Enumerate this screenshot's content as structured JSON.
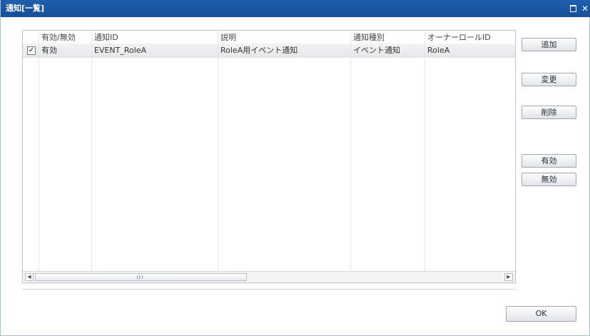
{
  "window": {
    "title": "通知[一覧]",
    "close_glyph": "✕"
  },
  "grid": {
    "columns": [
      "有効/無効",
      "通知ID",
      "説明",
      "通知種別",
      "オーナーロールID"
    ],
    "rows": [
      {
        "checked": true,
        "check_glyph": "✓",
        "status": "有効",
        "notification_id": "EVENT_RoleA",
        "description": "RoleA用イベント通知",
        "type": "イベント通知",
        "owner_role_id": "RoleA"
      }
    ],
    "scroll_left_glyph": "◀",
    "scroll_right_glyph": "▶"
  },
  "buttons": {
    "add": "追加",
    "change": "変更",
    "delete": "削除",
    "enable": "有効",
    "disable": "無効",
    "ok": "OK"
  },
  "colors": {
    "titlebar": "#1e5fae",
    "row_highlight": "#e4e6ea"
  }
}
